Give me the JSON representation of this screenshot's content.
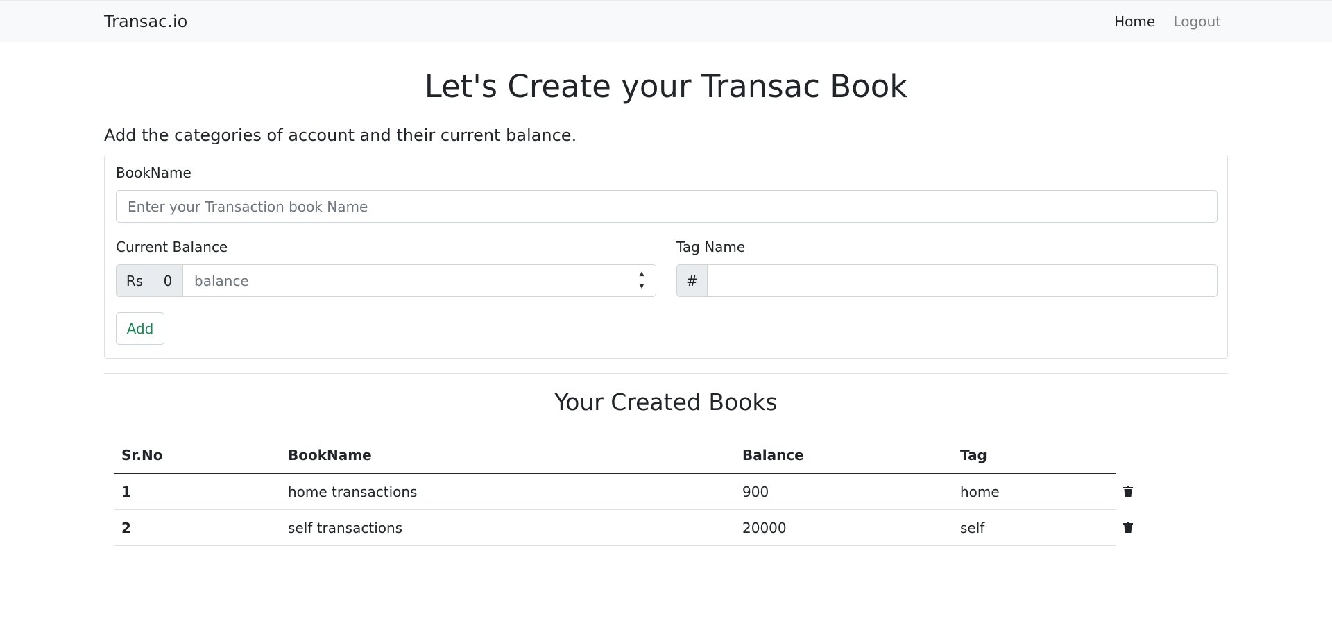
{
  "navbar": {
    "brand": "Transac.io",
    "links": {
      "home": "Home",
      "logout": "Logout"
    }
  },
  "page_title": "Let's Create your Transac Book",
  "subtitle": "Add the categories of account and their current balance.",
  "form": {
    "book_name_label": "BookName",
    "book_name_placeholder": "Enter your Transaction book Name",
    "balance_label": "Current Balance",
    "balance_currency": "Rs",
    "balance_prefix": "0",
    "balance_placeholder": "balance",
    "tag_label": "Tag Name",
    "tag_prefix": "#",
    "add_button": "Add"
  },
  "books_section": {
    "title": "Your Created Books",
    "columns": [
      "Sr.No",
      "BookName",
      "Balance",
      "Tag"
    ],
    "rows": [
      {
        "sr": "1",
        "name": "home transactions",
        "balance": "900",
        "tag": "home"
      },
      {
        "sr": "2",
        "name": "self transactions",
        "balance": "20000",
        "tag": "self"
      }
    ]
  },
  "icons": {
    "delete": "trash-icon",
    "spinner_up": "caret-up-icon",
    "spinner_down": "caret-down-icon"
  }
}
